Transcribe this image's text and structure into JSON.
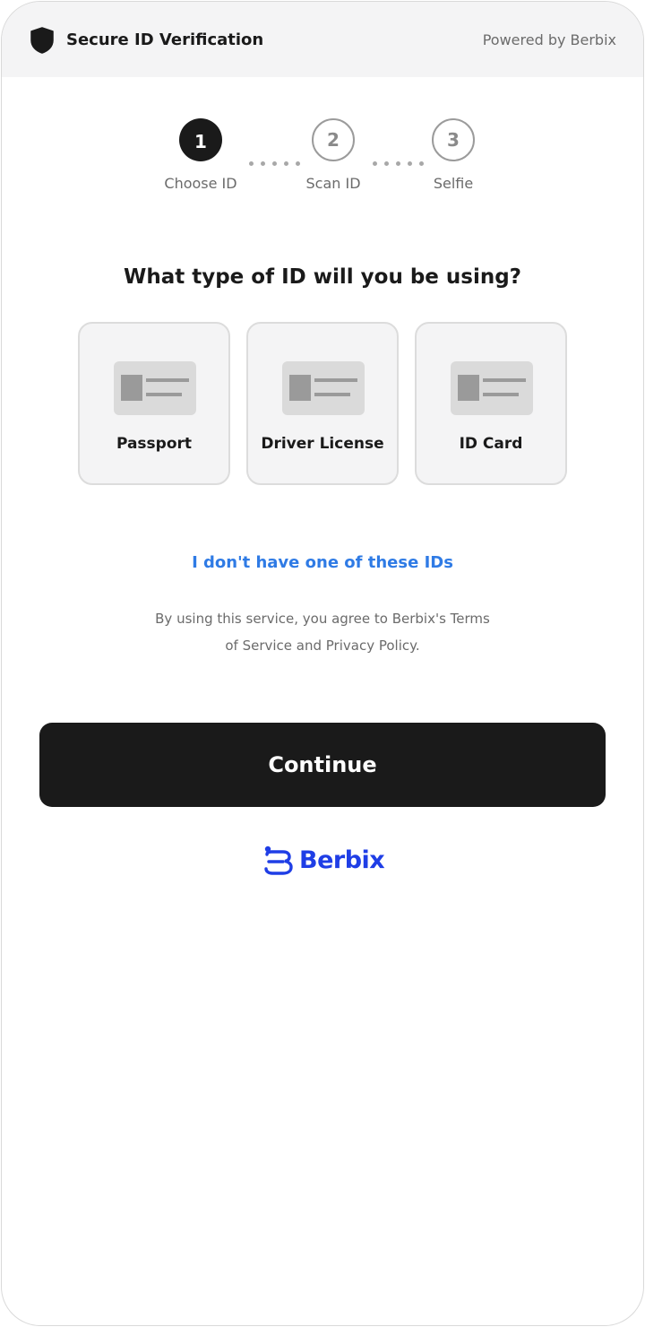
{
  "header": {
    "title": "Secure ID Verification",
    "powered_by": "Powered by Berbix",
    "icon": "shield-icon"
  },
  "stepper": {
    "current_step": 1,
    "steps": [
      {
        "number": "1",
        "label": "Choose ID",
        "state": "active"
      },
      {
        "number": "2",
        "label": "Scan ID",
        "state": "inactive"
      },
      {
        "number": "3",
        "label": "Selfie",
        "state": "inactive"
      }
    ]
  },
  "main": {
    "question": "What type of ID will you be using?",
    "id_options": [
      {
        "label": "Passport",
        "icon": "id-card-icon"
      },
      {
        "label": "Driver License",
        "icon": "id-card-icon"
      },
      {
        "label": "ID Card",
        "icon": "id-card-icon"
      }
    ],
    "no_id_link": "I don't have one of these IDs",
    "terms_line1": "By using this service, you agree to Berbix's Terms",
    "terms_line2": "of Service and Privacy Policy.",
    "continue_label": "Continue"
  },
  "brand": {
    "name": "Berbix",
    "icon": "berbix-logo-icon"
  },
  "colors": {
    "accent_dark": "#1a1a1a",
    "link_blue": "#2f7be5",
    "brand_blue": "#1f3ee6",
    "header_bg": "#f4f4f5",
    "card_bg": "#f4f4f5"
  }
}
